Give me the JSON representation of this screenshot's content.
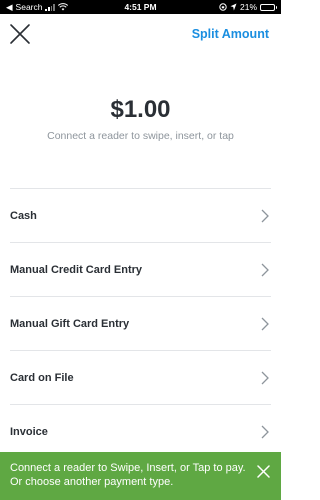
{
  "status_bar": {
    "carrier": "Search",
    "time": "4:51 PM",
    "battery": "21%"
  },
  "header": {
    "split_label": "Split Amount"
  },
  "amount": "$1.00",
  "hint": "Connect a reader to swipe, insert, or tap",
  "payment_options": [
    "Cash",
    "Manual Credit Card Entry",
    "Manual Gift Card Entry",
    "Card on File",
    "Invoice"
  ],
  "toast": {
    "message": "Connect a reader to Swipe, Insert, or Tap to pay. Or choose another payment type."
  },
  "colors": {
    "accent": "#1a8ee0",
    "toast_bg": "#5fa843"
  },
  "icons": {
    "close": "close-icon",
    "chevron": "chevron-right-icon"
  }
}
